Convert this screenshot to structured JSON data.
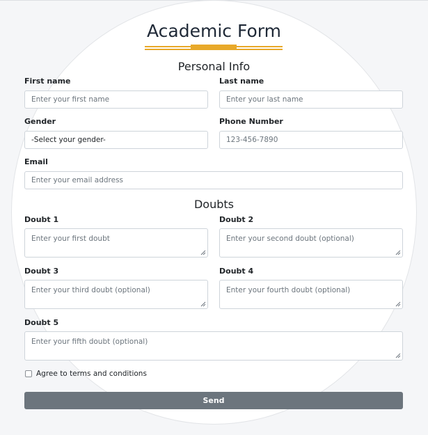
{
  "form": {
    "title": "Academic Form",
    "accent_color": "#e8a92a"
  },
  "personal_info": {
    "heading": "Personal Info",
    "first_name": {
      "label": "First name",
      "placeholder": "Enter your first name"
    },
    "last_name": {
      "label": "Last name",
      "placeholder": "Enter your last name"
    },
    "gender": {
      "label": "Gender",
      "selected": "-Select your gender-"
    },
    "phone": {
      "label": "Phone Number",
      "placeholder": "123-456-7890"
    },
    "email": {
      "label": "Email",
      "placeholder": "Enter your email address"
    }
  },
  "doubts": {
    "heading": "Doubts",
    "items": [
      {
        "label": "Doubt 1",
        "placeholder": "Enter your first doubt"
      },
      {
        "label": "Doubt 2",
        "placeholder": "Enter your second doubt (optional)"
      },
      {
        "label": "Doubt 3",
        "placeholder": "Enter your third doubt (optional)"
      },
      {
        "label": "Doubt 4",
        "placeholder": "Enter your fourth doubt (optional)"
      },
      {
        "label": "Doubt 5",
        "placeholder": "Enter your fifth doubt (optional)"
      }
    ]
  },
  "terms": {
    "label": "Agree to terms and conditions",
    "checked": false
  },
  "submit": {
    "label": "Send",
    "color": "#6c757d"
  }
}
